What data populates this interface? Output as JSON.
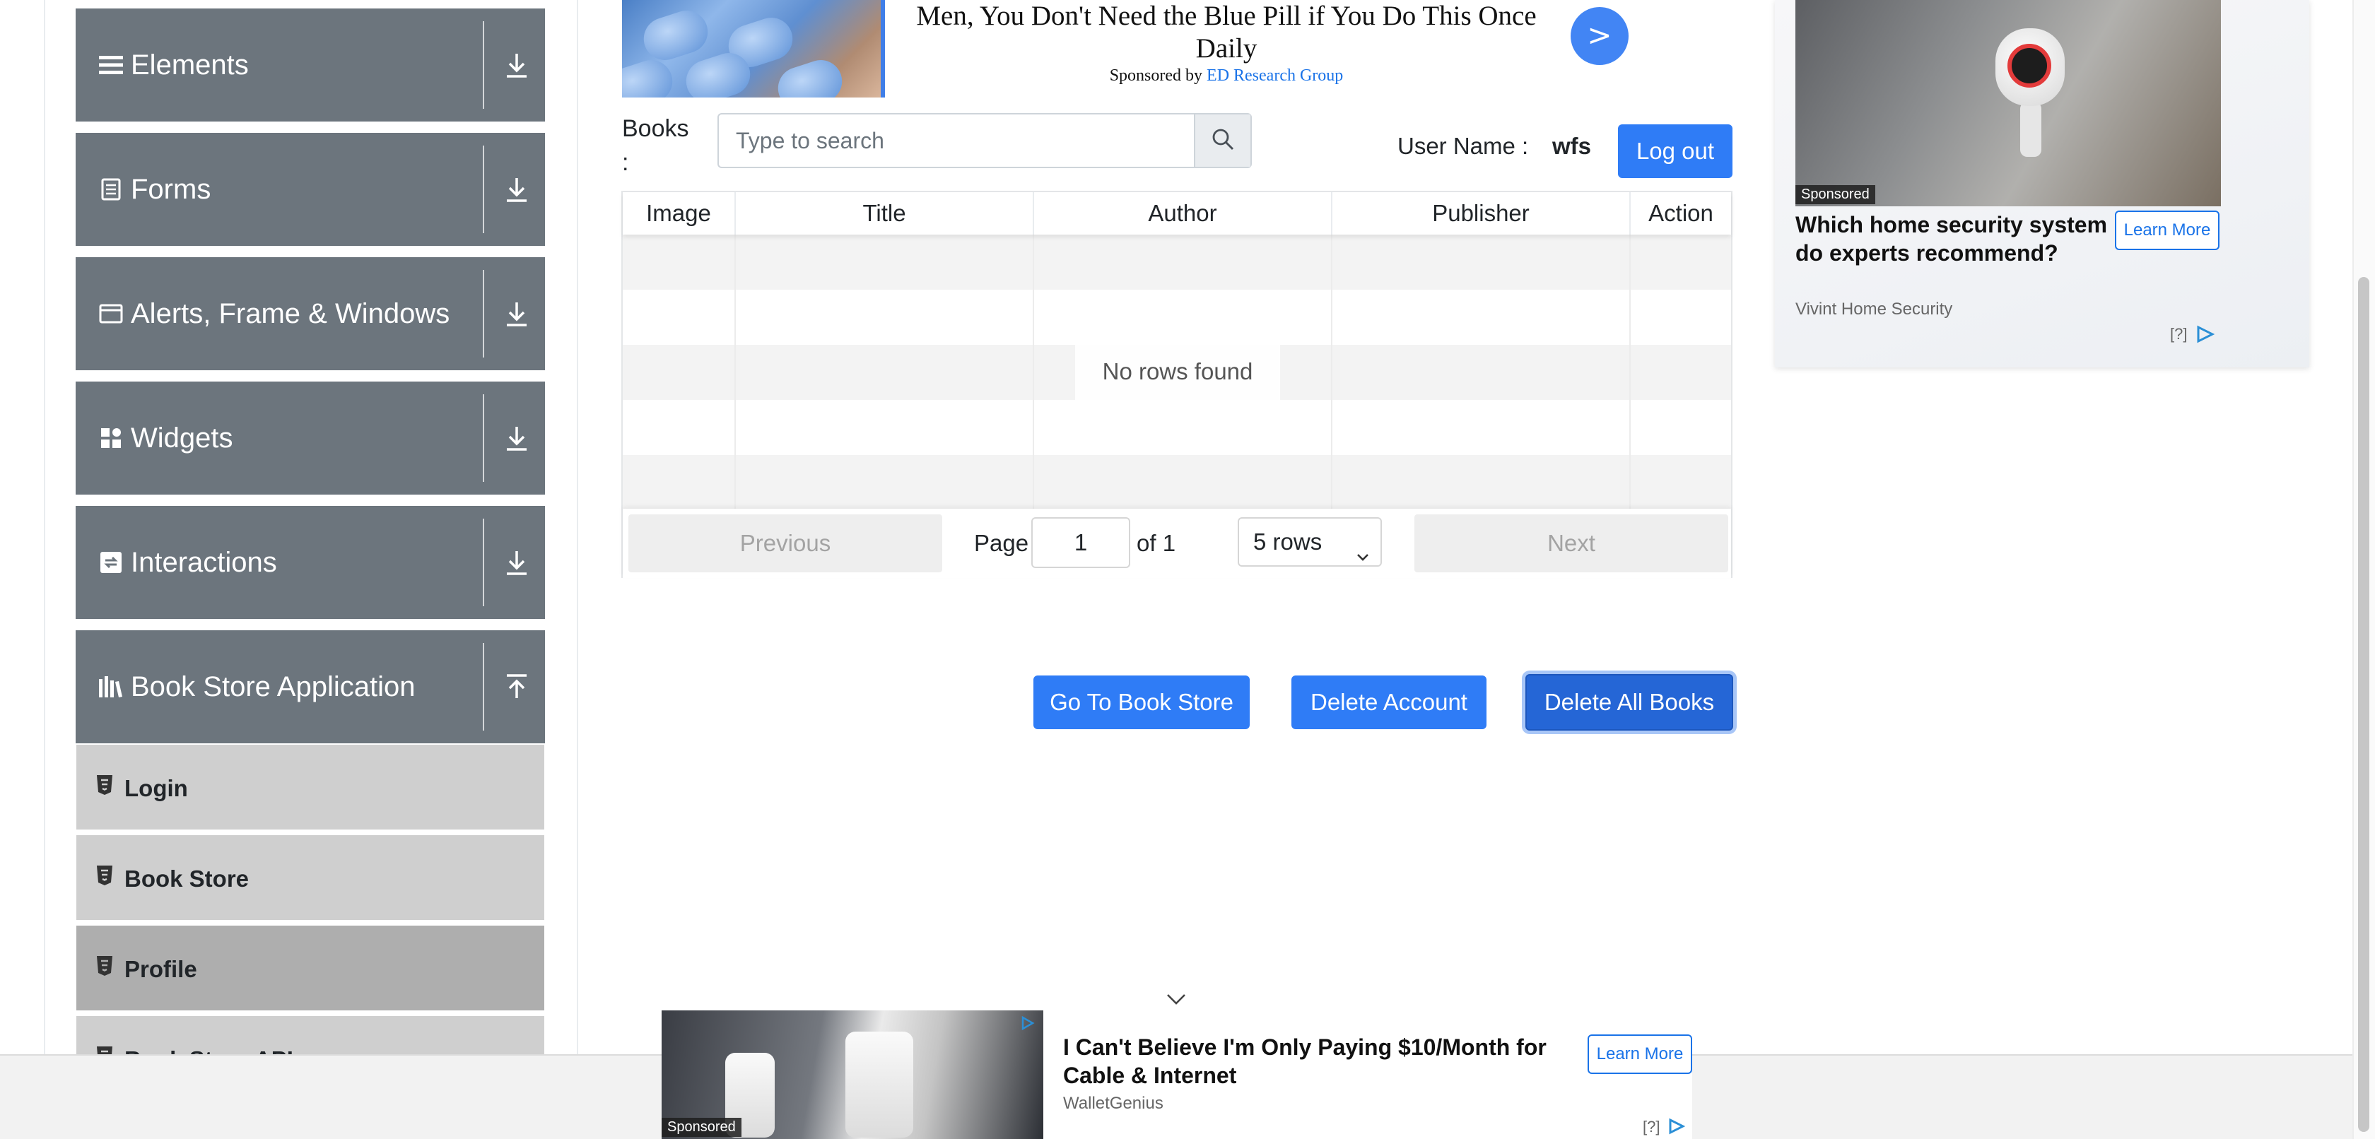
{
  "sidebar": {
    "groups": [
      {
        "label": "Elements",
        "icon": "hamburger-icon"
      },
      {
        "label": "Forms",
        "icon": "document-icon"
      },
      {
        "label": "Alerts, Frame & Windows",
        "icon": "window-icon"
      },
      {
        "label": "Widgets",
        "icon": "widgets-icon"
      },
      {
        "label": "Interactions",
        "icon": "interactions-icon"
      },
      {
        "label": "Book Store Application",
        "icon": "books-icon"
      }
    ],
    "items": [
      {
        "label": "Login"
      },
      {
        "label": "Book Store"
      },
      {
        "label": "Profile"
      },
      {
        "label": "Book Store API"
      }
    ]
  },
  "top_ad": {
    "headline": "Men, You Don't Need the Blue Pill if You Do This Once Daily",
    "sponsor_prefix": "Sponsored by",
    "sponsor_brand": "ED Research Group",
    "go_label": ">"
  },
  "search": {
    "label": "Books :",
    "placeholder": "Type to search"
  },
  "user": {
    "label": "User Name :",
    "value": "wfs",
    "logout_label": "Log out"
  },
  "table": {
    "columns": [
      "Image",
      "Title",
      "Author",
      "Publisher",
      "Action"
    ],
    "empty_text": "No rows found",
    "pagination": {
      "previous": "Previous",
      "page_label": "Page",
      "page_value": "1",
      "of_label": "of 1",
      "rows_option": "5 rows",
      "next": "Next"
    }
  },
  "actions": {
    "go_to_store": "Go To Book Store",
    "delete_account": "Delete Account",
    "delete_all_books": "Delete All Books"
  },
  "right_ad": {
    "sponsored": "Sponsored",
    "headline": "Which home security system do experts recommend?",
    "learn_more": "Learn More",
    "brand": "Vivint Home Security",
    "adchoice": "[?]"
  },
  "bottom_ad": {
    "sponsored": "Sponsored",
    "headline": "I Can't Believe I'm Only Paying $10/Month for Cable & Internet",
    "learn_more": "Learn More",
    "brand": "WalletGenius",
    "adchoice": "[?]"
  },
  "colors": {
    "accent": "#2f7cf6",
    "sidebar_header": "#6c757d",
    "sidebar_item": "#cfcfcf",
    "sidebar_item_active": "#aeaeae"
  }
}
